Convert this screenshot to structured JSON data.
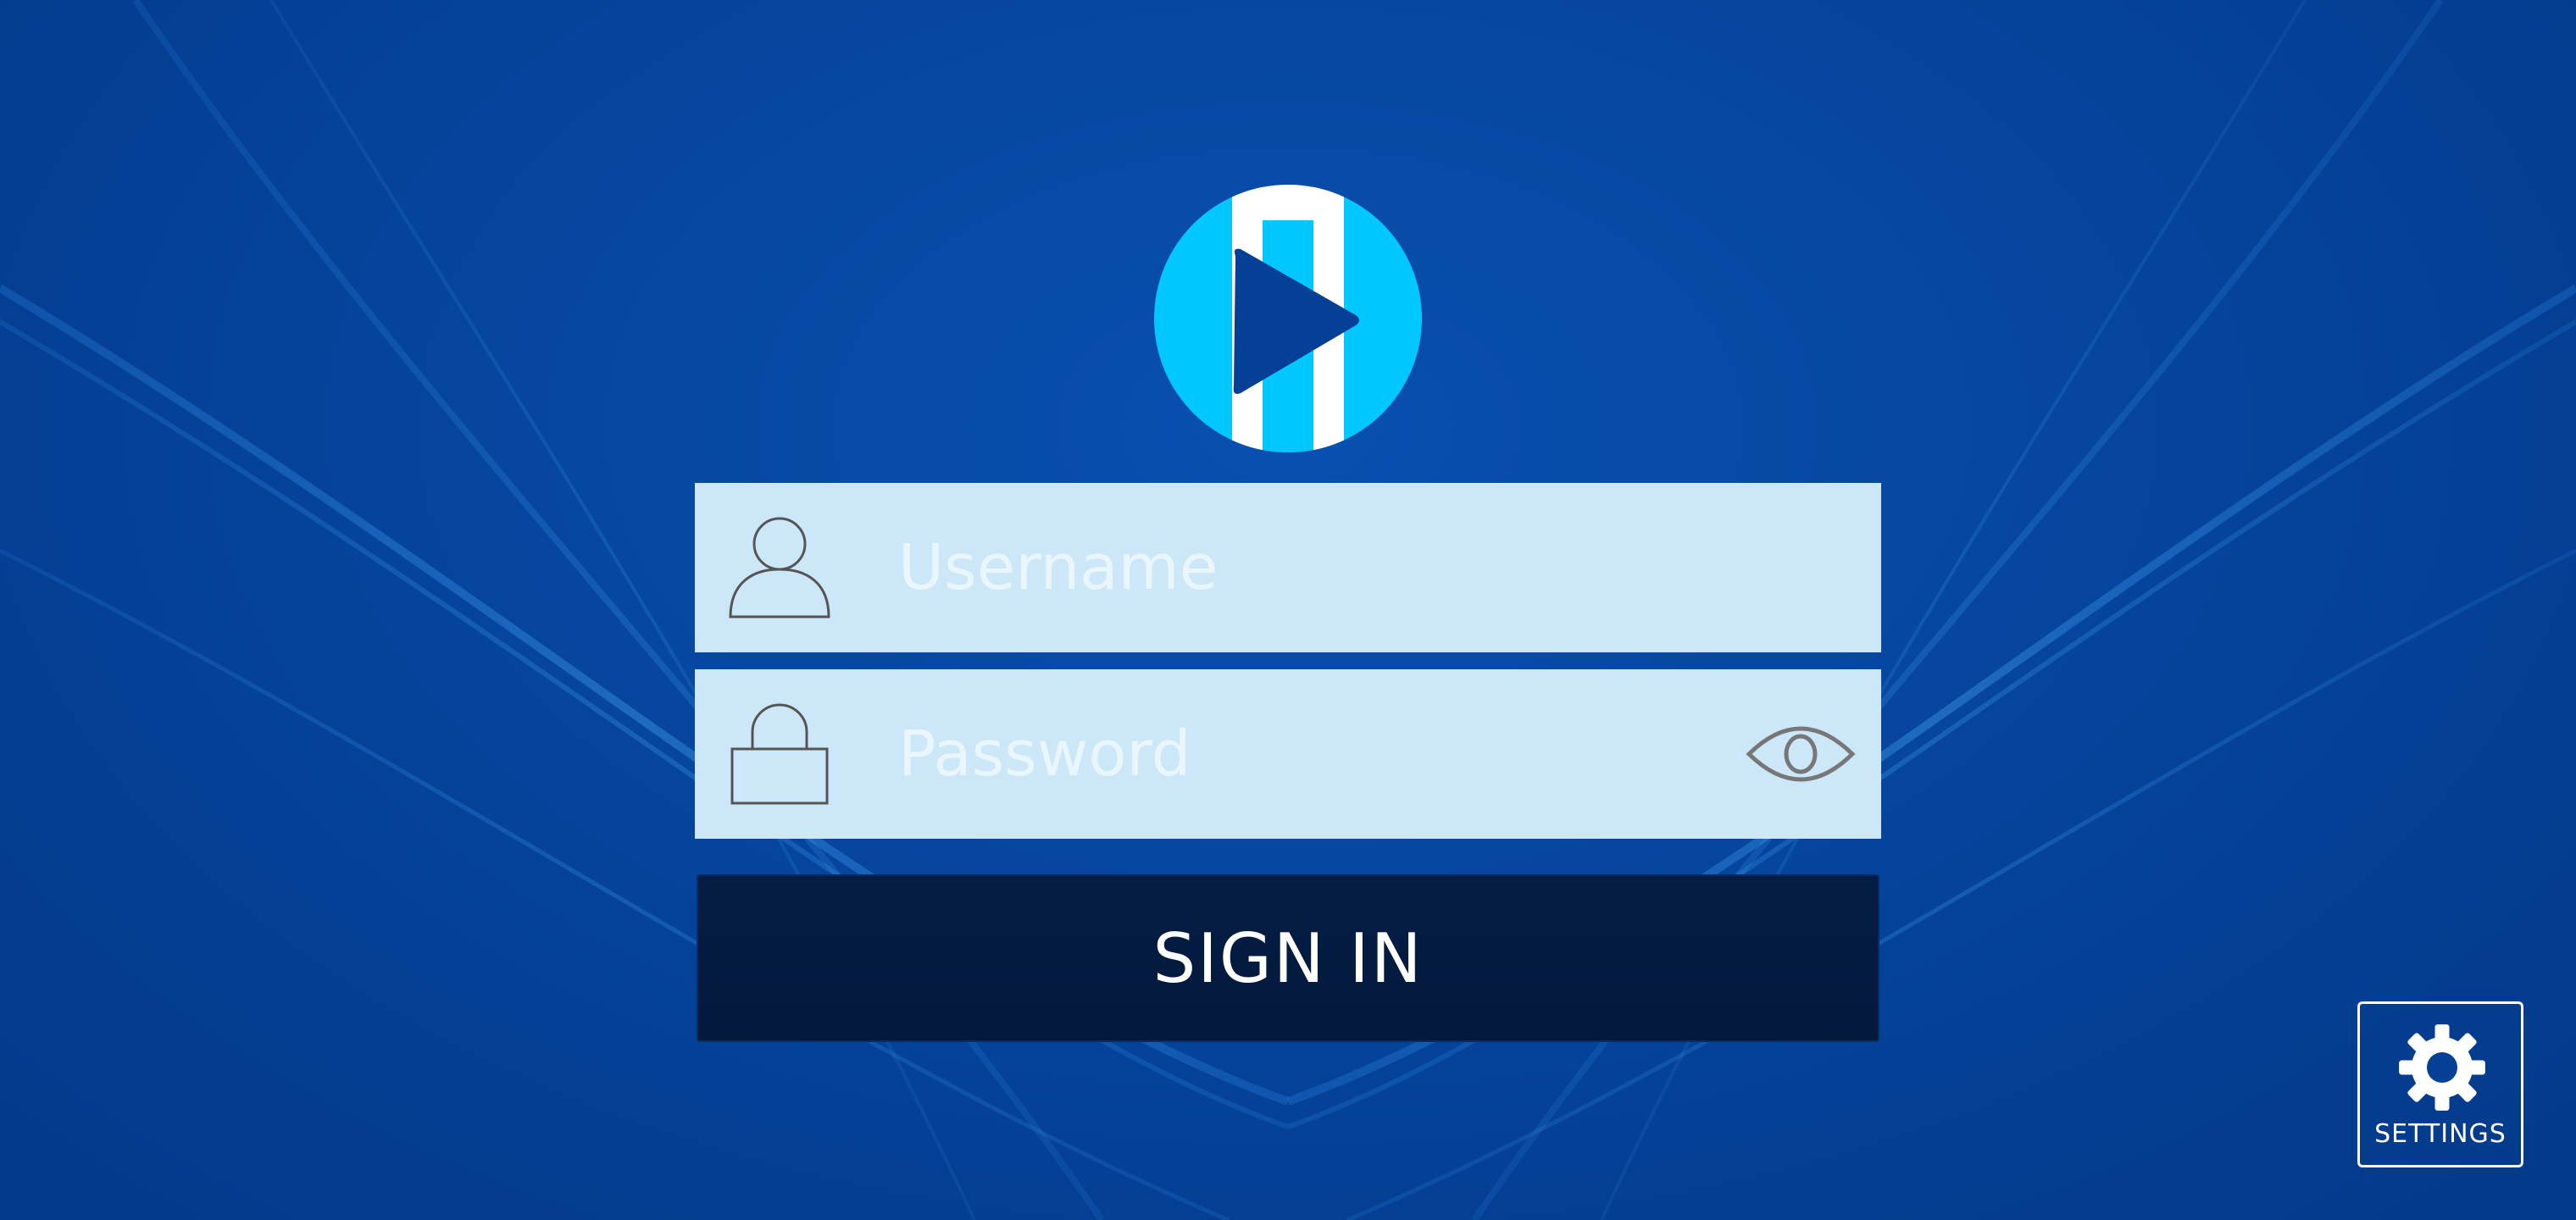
{
  "colors": {
    "background": "#0648a3",
    "field_background": "#cce8f8",
    "placeholder_text": "#e9f6fd",
    "signin_button": "#03193d",
    "logo_accent": "#00c8ff",
    "icon_stroke": "#555555",
    "eye_stroke": "#777777"
  },
  "logo": {
    "icon": "play-logo-icon"
  },
  "login": {
    "username": {
      "icon": "user-icon",
      "placeholder": "Username",
      "value": ""
    },
    "password": {
      "icon": "lock-icon",
      "placeholder": "Password",
      "value": "",
      "toggle_icon": "eye-icon"
    },
    "signin_label": "SIGN IN"
  },
  "settings": {
    "icon": "gear-icon",
    "label": "SETTINGS"
  }
}
